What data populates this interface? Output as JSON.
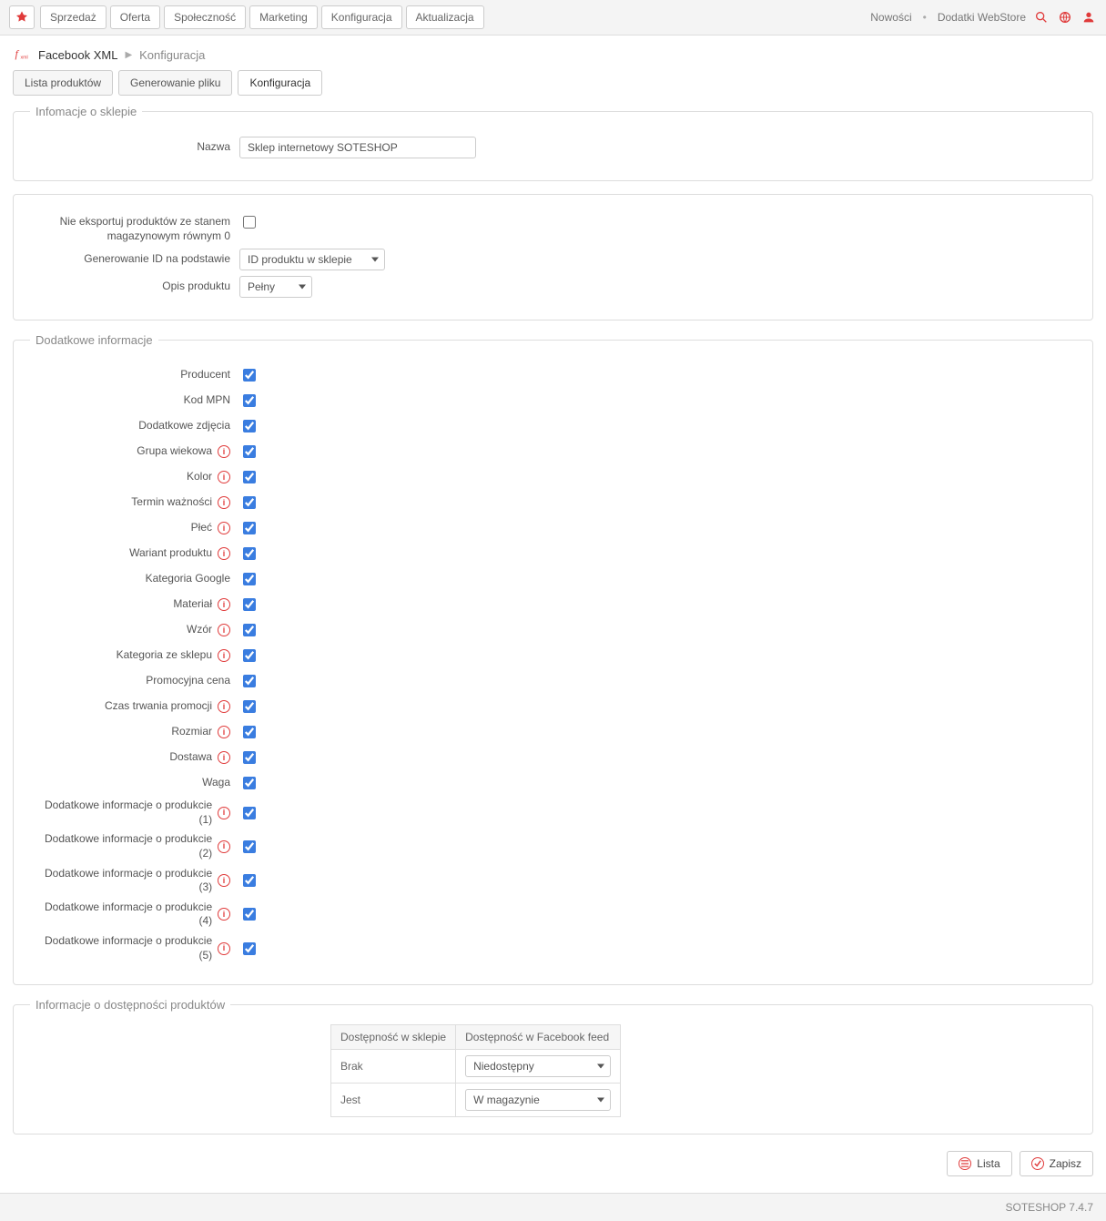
{
  "topbar": {
    "menu": [
      "Sprzedaż",
      "Oferta",
      "Społeczność",
      "Marketing",
      "Konfiguracja",
      "Aktualizacja"
    ],
    "right_links": [
      "Nowości",
      "Dodatki WebStore"
    ]
  },
  "breadcrumb": {
    "title": "Facebook XML",
    "sub": "Konfiguracja"
  },
  "tabs": [
    {
      "label": "Lista produktów",
      "active": false
    },
    {
      "label": "Generowanie pliku",
      "active": false
    },
    {
      "label": "Konfiguracja",
      "active": true
    }
  ],
  "fieldset1": {
    "legend": "Infomacje o sklepie",
    "name_label": "Nazwa",
    "name_value": "Sklep internetowy SOTESHOP"
  },
  "fieldset2": {
    "no_export_label": "Nie eksportuj produktów ze stanem magazynowym równym 0",
    "gen_id_label": "Generowanie ID na podstawie",
    "gen_id_value": "ID produktu w sklepie",
    "desc_label": "Opis produktu",
    "desc_value": "Pełny"
  },
  "fieldset3": {
    "legend": "Dodatkowe informacje",
    "items": [
      {
        "label": "Producent",
        "info": false,
        "checked": true
      },
      {
        "label": "Kod MPN",
        "info": false,
        "checked": true
      },
      {
        "label": "Dodatkowe zdjęcia",
        "info": false,
        "checked": true
      },
      {
        "label": "Grupa wiekowa",
        "info": true,
        "checked": true
      },
      {
        "label": "Kolor",
        "info": true,
        "checked": true
      },
      {
        "label": "Termin ważności",
        "info": true,
        "checked": true
      },
      {
        "label": "Płeć",
        "info": true,
        "checked": true
      },
      {
        "label": "Wariant produktu",
        "info": true,
        "checked": true
      },
      {
        "label": "Kategoria Google",
        "info": false,
        "checked": true
      },
      {
        "label": "Materiał",
        "info": true,
        "checked": true
      },
      {
        "label": "Wzór",
        "info": true,
        "checked": true
      },
      {
        "label": "Kategoria ze sklepu",
        "info": true,
        "checked": true
      },
      {
        "label": "Promocyjna cena",
        "info": false,
        "checked": true
      },
      {
        "label": "Czas trwania promocji",
        "info": true,
        "checked": true
      },
      {
        "label": "Rozmiar",
        "info": true,
        "checked": true
      },
      {
        "label": "Dostawa",
        "info": true,
        "checked": true
      },
      {
        "label": "Waga",
        "info": false,
        "checked": true
      },
      {
        "label": "Dodatkowe informacje o produkcie (1)",
        "info": true,
        "checked": true
      },
      {
        "label": "Dodatkowe informacje o produkcie (2)",
        "info": true,
        "checked": true
      },
      {
        "label": "Dodatkowe informacje o produkcie (3)",
        "info": true,
        "checked": true
      },
      {
        "label": "Dodatkowe informacje o produkcie (4)",
        "info": true,
        "checked": true
      },
      {
        "label": "Dodatkowe informacje o produkcie (5)",
        "info": true,
        "checked": true
      }
    ]
  },
  "fieldset4": {
    "legend": "Informacje o dostępności produktów",
    "th1": "Dostępność w sklepie",
    "th2": "Dostępność w Facebook feed",
    "rows": [
      {
        "label": "Brak",
        "value": "Niedostępny"
      },
      {
        "label": "Jest",
        "value": "W magazynie"
      }
    ]
  },
  "actions": {
    "list": "Lista",
    "save": "Zapisz"
  },
  "footer": "SOTESHOP 7.4.7"
}
